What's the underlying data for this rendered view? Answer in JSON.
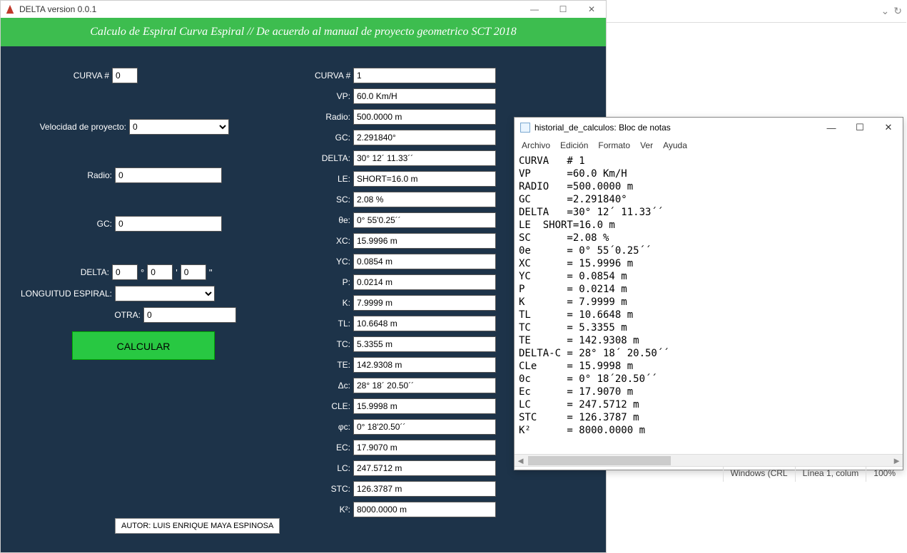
{
  "delta": {
    "title": "DELTA version 0.0.1",
    "header": "Calculo de Espiral Curva Espiral // De acuerdo al manual de proyecto geometrico SCT 2018",
    "inputs": {
      "curva_label": "CURVA #",
      "curva_val": "0",
      "vp_label": "Velocidad de proyecto:",
      "vp_val": "0",
      "radio_label": "Radio:",
      "radio_val": "0",
      "gc_label": "GC:",
      "gc_val": "0",
      "delta_label": "DELTA:",
      "delta_deg": "0",
      "delta_min": "0",
      "delta_sec": "0",
      "deg_sym": "°",
      "min_sym": "'",
      "sec_sym": "''",
      "le_label": "LONGUITUD ESPIRAL:",
      "otra_label": "OTRA:",
      "otra_val": "0",
      "calcular": "CALCULAR"
    },
    "outputs": {
      "curva_label": "CURVA #",
      "curva_val": "1",
      "vp_label": "VP:",
      "vp_val": "60.0 Km/H",
      "radio_label": "Radio:",
      "radio_val": "500.0000 m",
      "gc_label": "GC:",
      "gc_val": "2.291840°",
      "delta_label": "DELTA:",
      "delta_val": "30° 12´ 11.33´´",
      "le_label": "LE:",
      "le_val": "SHORT=16.0 m",
      "sc_label": "SC:",
      "sc_val": "2.08 %",
      "thetae_label": "θe:",
      "thetae_val": "0° 55'0.25´´",
      "xc_label": "XC:",
      "xc_val": "15.9996 m",
      "yc_label": "YC:",
      "yc_val": "0.0854 m",
      "p_label": "P:",
      "p_val": "0.0214 m",
      "k_label": "K:",
      "k_val": "7.9999 m",
      "tl_label": "TL:",
      "tl_val": "10.6648 m",
      "tc_label": "TC:",
      "tc_val": "5.3355 m",
      "te_label": "TE:",
      "te_val": "142.9308 m",
      "deltac_label": "Δc:",
      "deltac_val": "28° 18´ 20.50´´",
      "cle_label": "CLE:",
      "cle_val": "15.9998 m",
      "phic_label": "φc:",
      "phic_val": "0° 18'20.50´´",
      "ec_label": "EC:",
      "ec_val": "17.9070 m",
      "lc_label": "LC:",
      "lc_val": "247.5712 m",
      "stc_label": "STC:",
      "stc_val": "126.3787 m",
      "k2_label": "K²:",
      "k2_val": "8000.0000 m"
    },
    "author": "AUTOR: LUIS ENRIQUE MAYA ESPINOSA"
  },
  "notepad": {
    "title": "historial_de_calculos: Bloc de notas",
    "menu": {
      "archivo": "Archivo",
      "edicion": "Edición",
      "formato": "Formato",
      "ver": "Ver",
      "ayuda": "Ayuda"
    },
    "content": "CURVA   # 1\nVP      =60.0 Km/H\nRADIO   =500.0000 m\nGC      =2.291840°\nDELTA   =30° 12´ 11.33´´\nLE  SHORT=16.0 m\nSC      =2.08 %\n0e      = 0° 55´0.25´´\nXC      = 15.9996 m\nYC      = 0.0854 m\nP       = 0.0214 m\nK       = 7.9999 m\nTL      = 10.6648 m\nTC      = 5.3355 m\nTE      = 142.9308 m\nDELTA-C = 28° 18´ 20.50´´\nCLe     = 15.9998 m\n0c      = 0° 18´20.50´´\nEc      = 17.9070 m\nLC      = 247.5712 m\nSTC     = 126.3787 m\nK²      = 8000.0000 m",
    "status": {
      "encoding": "Windows (CRL",
      "pos": "Línea 1, colum",
      "zoom": "100%"
    }
  }
}
